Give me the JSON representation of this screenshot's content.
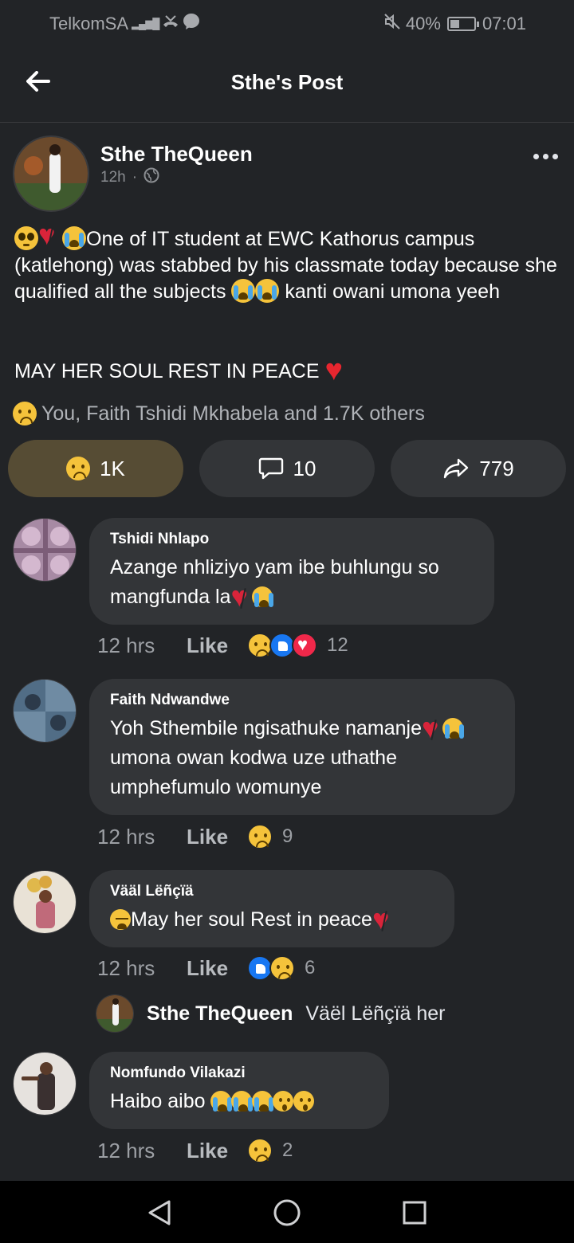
{
  "status_bar": {
    "carrier": "TelkomSA",
    "network": "4G",
    "battery": "40%",
    "battery_level": 0.4,
    "time": "07:01",
    "icons": [
      "signal-icon",
      "missed-call-icon",
      "messenger-icon",
      "mute-icon",
      "battery-icon"
    ]
  },
  "header": {
    "title": "Sthe's Post",
    "back_icon": "arrow-left-icon"
  },
  "post": {
    "author": "Sthe TheQueen",
    "time": "12h",
    "separator": "·",
    "privacy_icon": "globe-icon",
    "text_line1_part1": "One of IT student at EWC Kathorus campus (katlehong) was stabbed by his classmate today because she qualified all the subjects",
    "text_line1_part2": "kanti owani umona yeeh",
    "text_line2": "MAY HER SOUL REST IN PEACE",
    "reaction_summary": "You, Faith Tshidi Mkhabela and 1.7K others"
  },
  "actions": {
    "reactions": "1K",
    "comments": "10",
    "shares": "779"
  },
  "comments": [
    {
      "name": "Tshidi Nhlapo",
      "text": "Azange nhliziyo yam ibe buhlungu so mangfunda la",
      "time": "12 hrs",
      "like": "Like",
      "count": "12"
    },
    {
      "name": "Faith Ndwandwe",
      "text_part1": "Yoh Sthembile ngisathuke namanje",
      "text_part2": "umona owan kodwa uze uthathe umphefumulo womunye",
      "time": "12 hrs",
      "like": "Like",
      "count": "9"
    },
    {
      "name": "Vääl Lëñçïä",
      "text": "May her soul Rest in peace",
      "time": "12 hrs",
      "like": "Like",
      "count": "6"
    },
    {
      "name": "Nomfundo Vilakazi",
      "text": "Haibo aibo",
      "time": "12 hrs",
      "like": "Like",
      "count": "2"
    }
  ],
  "reply": {
    "name": "Sthe TheQueen",
    "text": "Väël Lëñçïä her"
  },
  "colors": {
    "background": "#222427",
    "bubble": "#333538",
    "active_reaction": "#564c34",
    "like_blue": "#1877f2",
    "heart_red": "#e8262f"
  }
}
